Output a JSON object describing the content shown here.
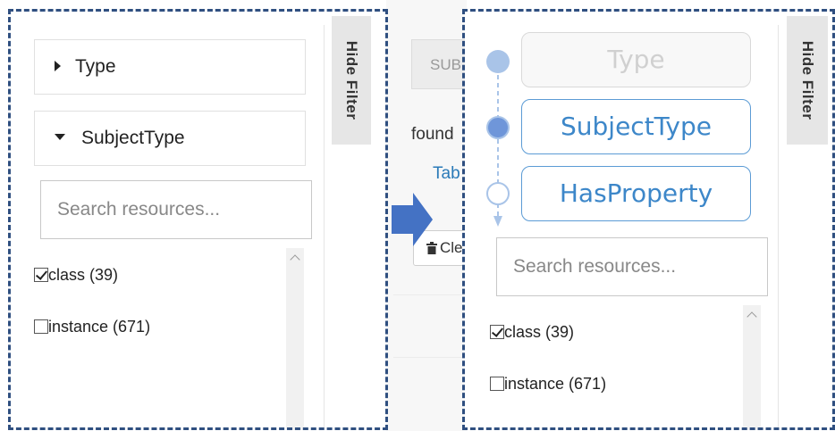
{
  "left_panel": {
    "groups": [
      {
        "label": "Type",
        "state": "collapsed"
      },
      {
        "label": "SubjectType",
        "state": "expanded"
      }
    ],
    "search": {
      "placeholder": "Search resources..."
    },
    "options": [
      {
        "label": "class (39)",
        "checked": true
      },
      {
        "label": "instance (671)",
        "checked": false
      }
    ],
    "hide_filter_label": "Hide Filter"
  },
  "background_page": {
    "sub_button_label": "SUB",
    "found_text": "found",
    "tab_link_text": "Tab",
    "clear_button_label": "Cle"
  },
  "right_panel": {
    "hierarchy": [
      {
        "label": "Type",
        "state": "inactive"
      },
      {
        "label": "SubjectType",
        "state": "selected"
      },
      {
        "label": "HasProperty",
        "state": "next"
      }
    ],
    "search": {
      "placeholder": "Search resources..."
    },
    "options": [
      {
        "label": "class (39)",
        "checked": true
      },
      {
        "label": "instance (671)",
        "checked": false
      }
    ],
    "hide_filter_label": "Hide Filter"
  },
  "colors": {
    "frame_dash": "#2f4f80",
    "accent_blue": "#4472c4",
    "pill_border": "#5b9bd5",
    "pill_text": "#3d87c9",
    "link_blue": "#2a7ab8"
  },
  "icons": {
    "transition": "arrow-right-icon",
    "collapsed": "triangle-right-icon",
    "expanded": "triangle-down-icon",
    "clear": "trash-icon"
  }
}
